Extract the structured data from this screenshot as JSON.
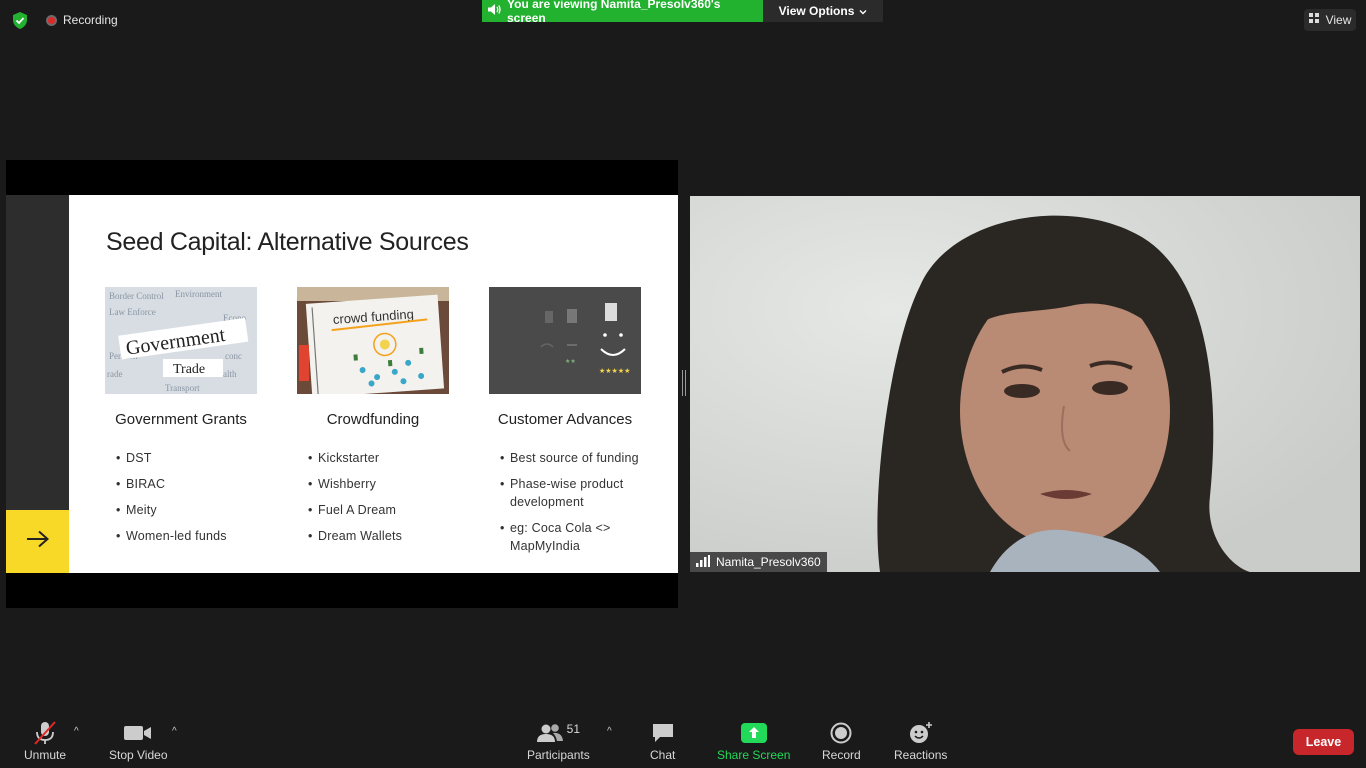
{
  "top_bar": {
    "recording_label": "Recording",
    "banner_text": "You are viewing Namita_Presolv360's screen",
    "view_options_label": "View Options",
    "view_label": "View"
  },
  "slide": {
    "title": "Seed Capital: Alternative Sources",
    "columns": [
      {
        "heading": "Government Grants",
        "image_words": [
          "Government",
          "Trade"
        ],
        "bullets": [
          "DST",
          "BIRAC",
          "Meity",
          "Women-led funds"
        ]
      },
      {
        "heading": "Crowdfunding",
        "image_words": [
          "crowd funding"
        ],
        "bullets": [
          "Kickstarter",
          "Wishberry",
          "Fuel A Dream",
          "Dream Wallets"
        ]
      },
      {
        "heading": "Customer Advances",
        "image_words": [
          "★★★★★"
        ],
        "bullets": [
          "Best source of funding",
          "Phase-wise product development",
          "eg: Coca Cola <> MapMyIndia"
        ]
      }
    ]
  },
  "video": {
    "participant_name": "Namita_Presolv360"
  },
  "toolbar": {
    "unmute_label": "Unmute",
    "stop_video_label": "Stop Video",
    "participants_label": "Participants",
    "participants_count": "51",
    "chat_label": "Chat",
    "share_screen_label": "Share Screen",
    "record_label": "Record",
    "reactions_label": "Reactions",
    "leave_label": "Leave"
  },
  "colors": {
    "banner_green": "#23b130",
    "leave_red": "#c7262a",
    "share_green": "#23d959",
    "slide_accent_yellow": "#f9d928"
  }
}
